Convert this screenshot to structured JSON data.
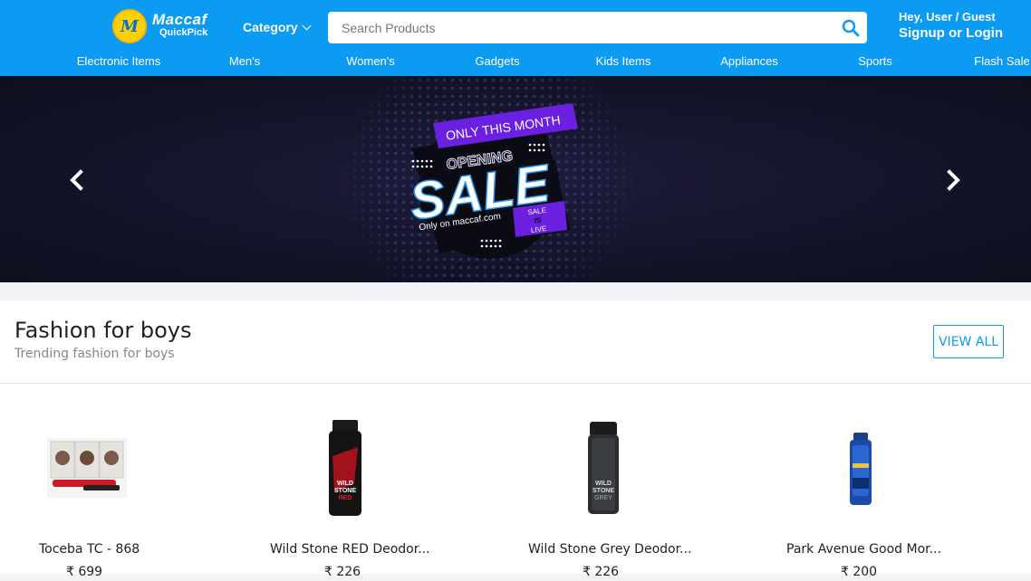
{
  "brand": {
    "name": "Maccaf",
    "sub": "QuickPick",
    "badge": "M"
  },
  "header": {
    "category_label": "Category",
    "search_placeholder": "Search Products",
    "greeting": "Hey, User / Guest",
    "login_label": "Signup or Login"
  },
  "nav": [
    "Electronic Items",
    "Men's",
    "Women's",
    "Gadgets",
    "Kids Items",
    "Appliances",
    "Sports",
    "Flash Sale"
  ],
  "banner": {
    "tag": "ONLY THIS MONTH",
    "line1": "OPENING",
    "headline": "SALE",
    "site": "Only on maccaf.com",
    "badge_top": "SALE",
    "badge_mid": "IS",
    "badge_bottom": "LIVE"
  },
  "section": {
    "title": "Fashion for boys",
    "subtitle": "Trending fashion for boys",
    "view_all": "VIEW ALL",
    "products": [
      {
        "name": "Toceba TC - 868",
        "price": "₹ 699"
      },
      {
        "name": "Wild Stone RED Deodor...",
        "price": "₹ 226"
      },
      {
        "name": "Wild Stone Grey Deodor...",
        "price": "₹ 226"
      },
      {
        "name": "Park Avenue Good Mor...",
        "price": "₹ 200"
      }
    ]
  },
  "colors": {
    "primary": "#0c9bf3",
    "logo_yellow": "#fbd100",
    "sale_purple": "#6b1fe0"
  }
}
